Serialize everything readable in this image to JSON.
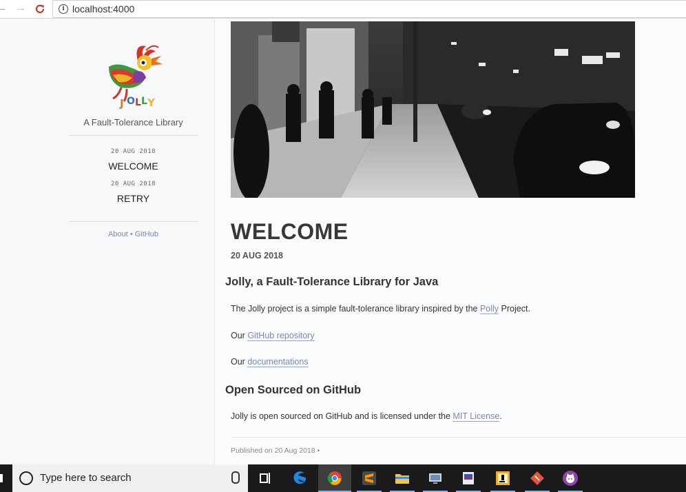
{
  "browser": {
    "url": "localhost:4000",
    "info_glyph": "i",
    "back_glyph": "←",
    "forward_glyph": "→",
    "reload_glyph": "C"
  },
  "sidebar": {
    "tagline": "A Fault-Tolerance Library",
    "posts": [
      {
        "date": "20 AUG 2018",
        "title": "WELCOME"
      },
      {
        "date": "20 AUG 2018",
        "title": "RETRY"
      }
    ],
    "links": {
      "about": "About",
      "separator": "•",
      "github": "GitHub"
    }
  },
  "article": {
    "title": "WELCOME",
    "date": "20 AUG 2018",
    "section1_heading": "Jolly, a Fault-Tolerance Library for Java",
    "p1_before": "The Jolly project is a simple fault-tolerance library inspired by the ",
    "p1_link": "Polly",
    "p1_after": " Project.",
    "p2_before": "Our ",
    "p2_link": "GitHub repository",
    "p3_before": "Our ",
    "p3_link": "documentations",
    "section2_heading": "Open Sourced on GitHub",
    "p4_before": "Jolly is open sourced on GitHub and is licensed under the ",
    "p4_link": "MIT License",
    "p4_after": ".",
    "published": "Published on 20 Aug 2018 •"
  },
  "taskbar": {
    "search_placeholder": "Type here to search",
    "apps": [
      "task-view-icon",
      "edge-icon",
      "chrome-icon",
      "sublime-icon",
      "file-explorer-icon",
      "network-icon",
      "photos-icon",
      "intellij-icon",
      "git-icon",
      "github-desktop-icon"
    ]
  },
  "colors": {
    "accent_link": "#7b86b8",
    "taskbar": "#1a1a1a",
    "chrome_red": "#c0392b"
  }
}
